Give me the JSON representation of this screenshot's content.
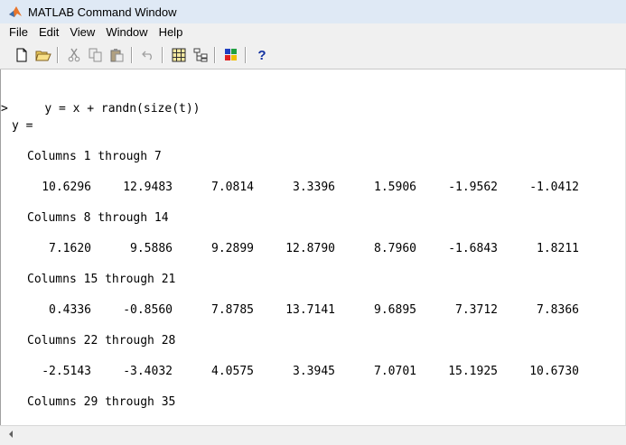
{
  "window": {
    "title": "MATLAB Command Window"
  },
  "menu": [
    "File",
    "Edit",
    "View",
    "Window",
    "Help"
  ],
  "toolbar": {
    "icons": [
      "new-file-icon",
      "open-folder-icon",
      "cut-icon",
      "copy-icon",
      "paste-icon",
      "undo-icon",
      "workspace-icon",
      "path-browser-icon",
      "simulink-icon",
      "help-icon"
    ],
    "help_label": "?"
  },
  "console": {
    "prompt": ">",
    "command": "y = x + randn(size(t))",
    "result_header": "y =",
    "blocks": [
      {
        "header": "Columns 1 through 7",
        "values": [
          "10.6296",
          "12.9483",
          "7.0814",
          "3.3396",
          "1.5906",
          "-1.9562",
          "-1.0412"
        ]
      },
      {
        "header": "Columns 8 through 14",
        "values": [
          "7.1620",
          "9.5886",
          "9.2899",
          "12.8790",
          "8.7960",
          "-1.6843",
          "1.8211"
        ]
      },
      {
        "header": "Columns 15 through 21",
        "values": [
          "0.4336",
          "-0.8560",
          "7.8785",
          "13.7141",
          "9.6895",
          "7.3712",
          "7.8366"
        ]
      },
      {
        "header": "Columns 22 through 28",
        "values": [
          "-2.5143",
          "-3.4032",
          "4.0575",
          "3.3945",
          "7.0701",
          "15.1925",
          "10.6730"
        ]
      },
      {
        "header": "Columns 29 through 35",
        "values": []
      }
    ]
  }
}
